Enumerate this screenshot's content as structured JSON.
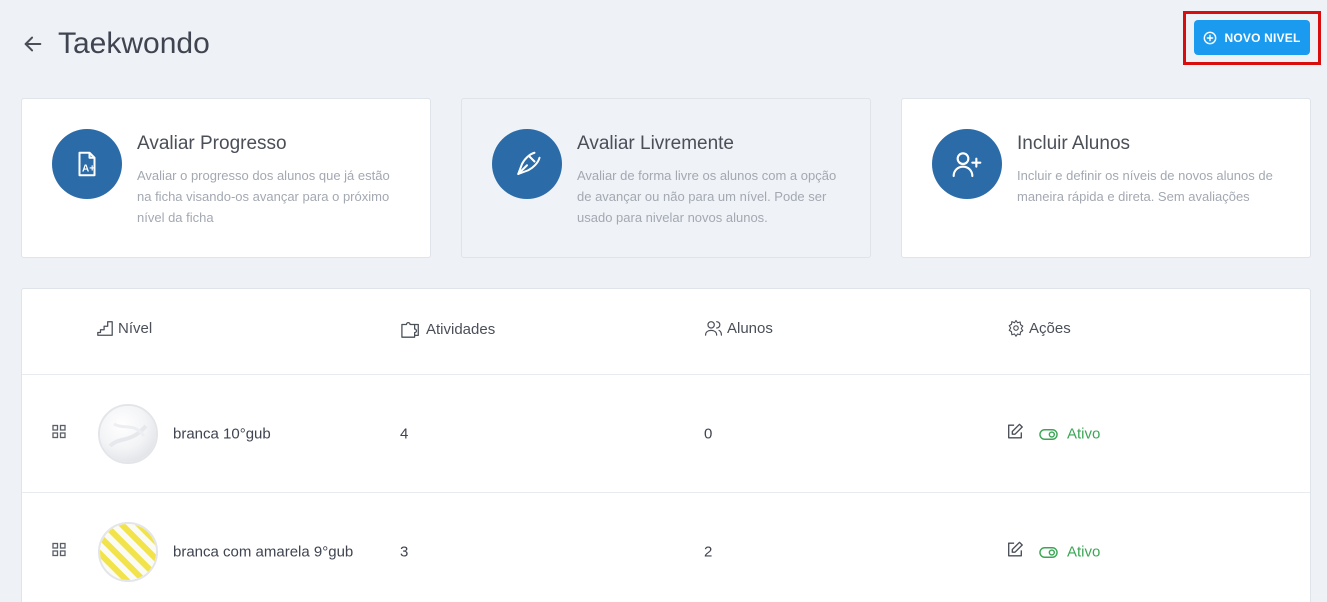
{
  "header": {
    "title": "Taekwondo",
    "new_button_label": "NOVO NIVEL"
  },
  "cards": [
    {
      "title": "Avaliar Progresso",
      "description": "Avaliar o progresso dos alunos que já estão na ficha visando-os avançar para o próximo nível da ficha"
    },
    {
      "title": "Avaliar Livremente",
      "description": "Avaliar de forma livre os alunos com a opção de avançar ou não para um nível. Pode ser usado para nivelar novos alunos."
    },
    {
      "title": "Incluir Alunos",
      "description": "Incluir e definir os níveis de novos alunos de maneira rápida e direta. Sem avaliações"
    }
  ],
  "table": {
    "columns": {
      "nivel": "Nível",
      "atividades": "Atividades",
      "alunos": "Alunos",
      "acoes": "Ações"
    },
    "rows": [
      {
        "name": "branca 10°gub",
        "atividades": "4",
        "alunos": "0",
        "status": "Ativo"
      },
      {
        "name": "branca com amarela 9°gub",
        "atividades": "3",
        "alunos": "2",
        "status": "Ativo"
      }
    ]
  },
  "colors": {
    "primary": "#1a9bf0",
    "card_icon": "#2b6ba8",
    "status_active": "#3aa655",
    "highlight": "#d90d0d"
  }
}
